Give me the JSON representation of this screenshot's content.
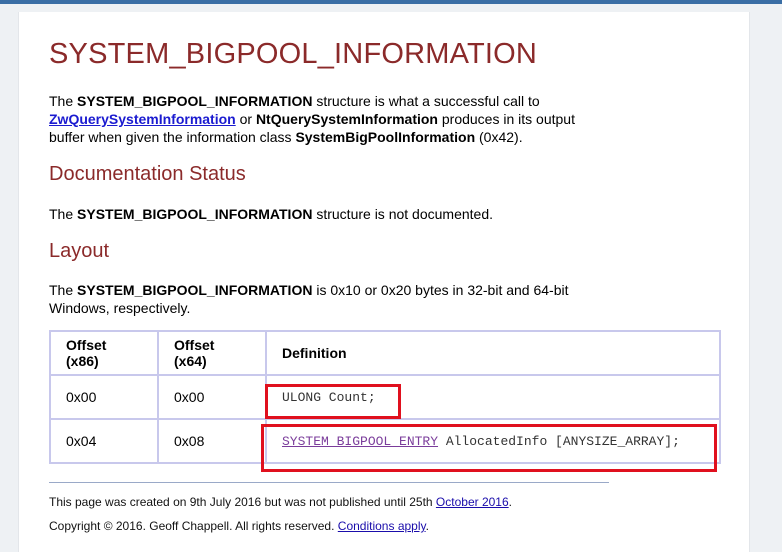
{
  "title": "SYSTEM_BIGPOOL_INFORMATION",
  "intro": {
    "t1": "The ",
    "b1": "SYSTEM_BIGPOOL_INFORMATION",
    "t2": " structure is what a successful call to ",
    "link1": "ZwQuerySystemInformation",
    "t3": " or ",
    "b2": "NtQuerySystemInformation",
    "t4": " produces in its output buffer when given the information class ",
    "b3": "SystemBigPoolInformation",
    "t5": " (0x42)."
  },
  "doc_status": {
    "heading": "Documentation Status",
    "t1": "The ",
    "b1": "SYSTEM_BIGPOOL_INFORMATION",
    "t2": " structure is not documented."
  },
  "layout": {
    "heading": "Layout",
    "t1": "The ",
    "b1": "SYSTEM_BIGPOOL_INFORMATION",
    "t2": " is 0x10 or 0x20 bytes in 32-bit and 64-bit Windows, respectively."
  },
  "table": {
    "headers": [
      "Offset (x86)",
      "Offset (x64)",
      "Definition"
    ],
    "rows": [
      {
        "x86": "0x00",
        "x64": "0x00",
        "def_text": "ULONG Count;"
      },
      {
        "x86": "0x04",
        "x64": "0x08",
        "def_link": "SYSTEM_BIGPOOL_ENTRY",
        "def_text": " AllocatedInfo [ANYSIZE_ARRAY];"
      }
    ]
  },
  "footer": {
    "line1": "This page was created on 9th July 2016 but was not published until 25th ",
    "line1_link": "October 2016",
    "line1_end": ".",
    "line2": "Copyright © 2016. Geoff Chappell. All rights reserved. ",
    "line2_link": "Conditions apply",
    "line2_end": "."
  },
  "colors": {
    "heading": "#8b2a2a",
    "highlight": "#e0101e",
    "table_border": "#c8c8ec"
  }
}
